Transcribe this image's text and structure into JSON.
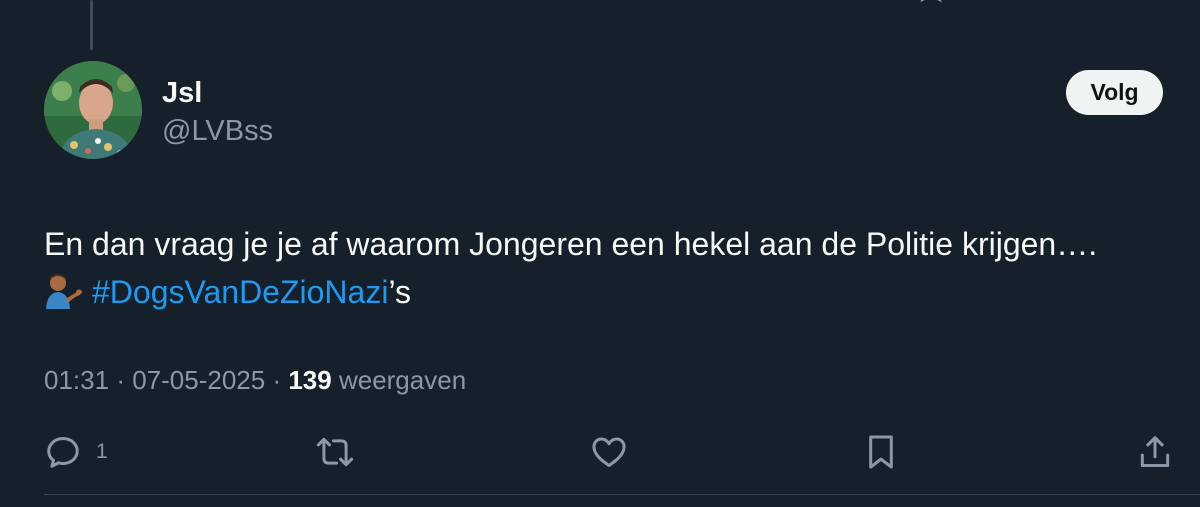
{
  "tweet": {
    "author": {
      "display_name": "Jsl",
      "handle": "@LVBss",
      "avatar_icon": "profile-photo"
    },
    "follow_label": "Volg",
    "text_line1": "En dan vraag je je af waarom Jongeren een hekel aan de Politie krijgen….",
    "emoji": "man-tipping-hand",
    "hashtag": "#DogsVanDeZioNazi",
    "hashtag_suffix": "’s",
    "time": "01:31",
    "date": "07-05-2025",
    "views_count": "139",
    "views_label": "weergaven",
    "reply_count": "1"
  },
  "colors": {
    "background": "#15202b",
    "text_primary": "#f7f9f9",
    "text_secondary": "#8b98a5",
    "link": "#1d9bf0",
    "follow_button_bg": "#eff3f4"
  },
  "actions": {
    "reply_icon": "reply-icon",
    "retweet_icon": "retweet-icon",
    "like_icon": "heart-icon",
    "bookmark_icon": "bookmark-icon",
    "share_icon": "share-icon"
  }
}
